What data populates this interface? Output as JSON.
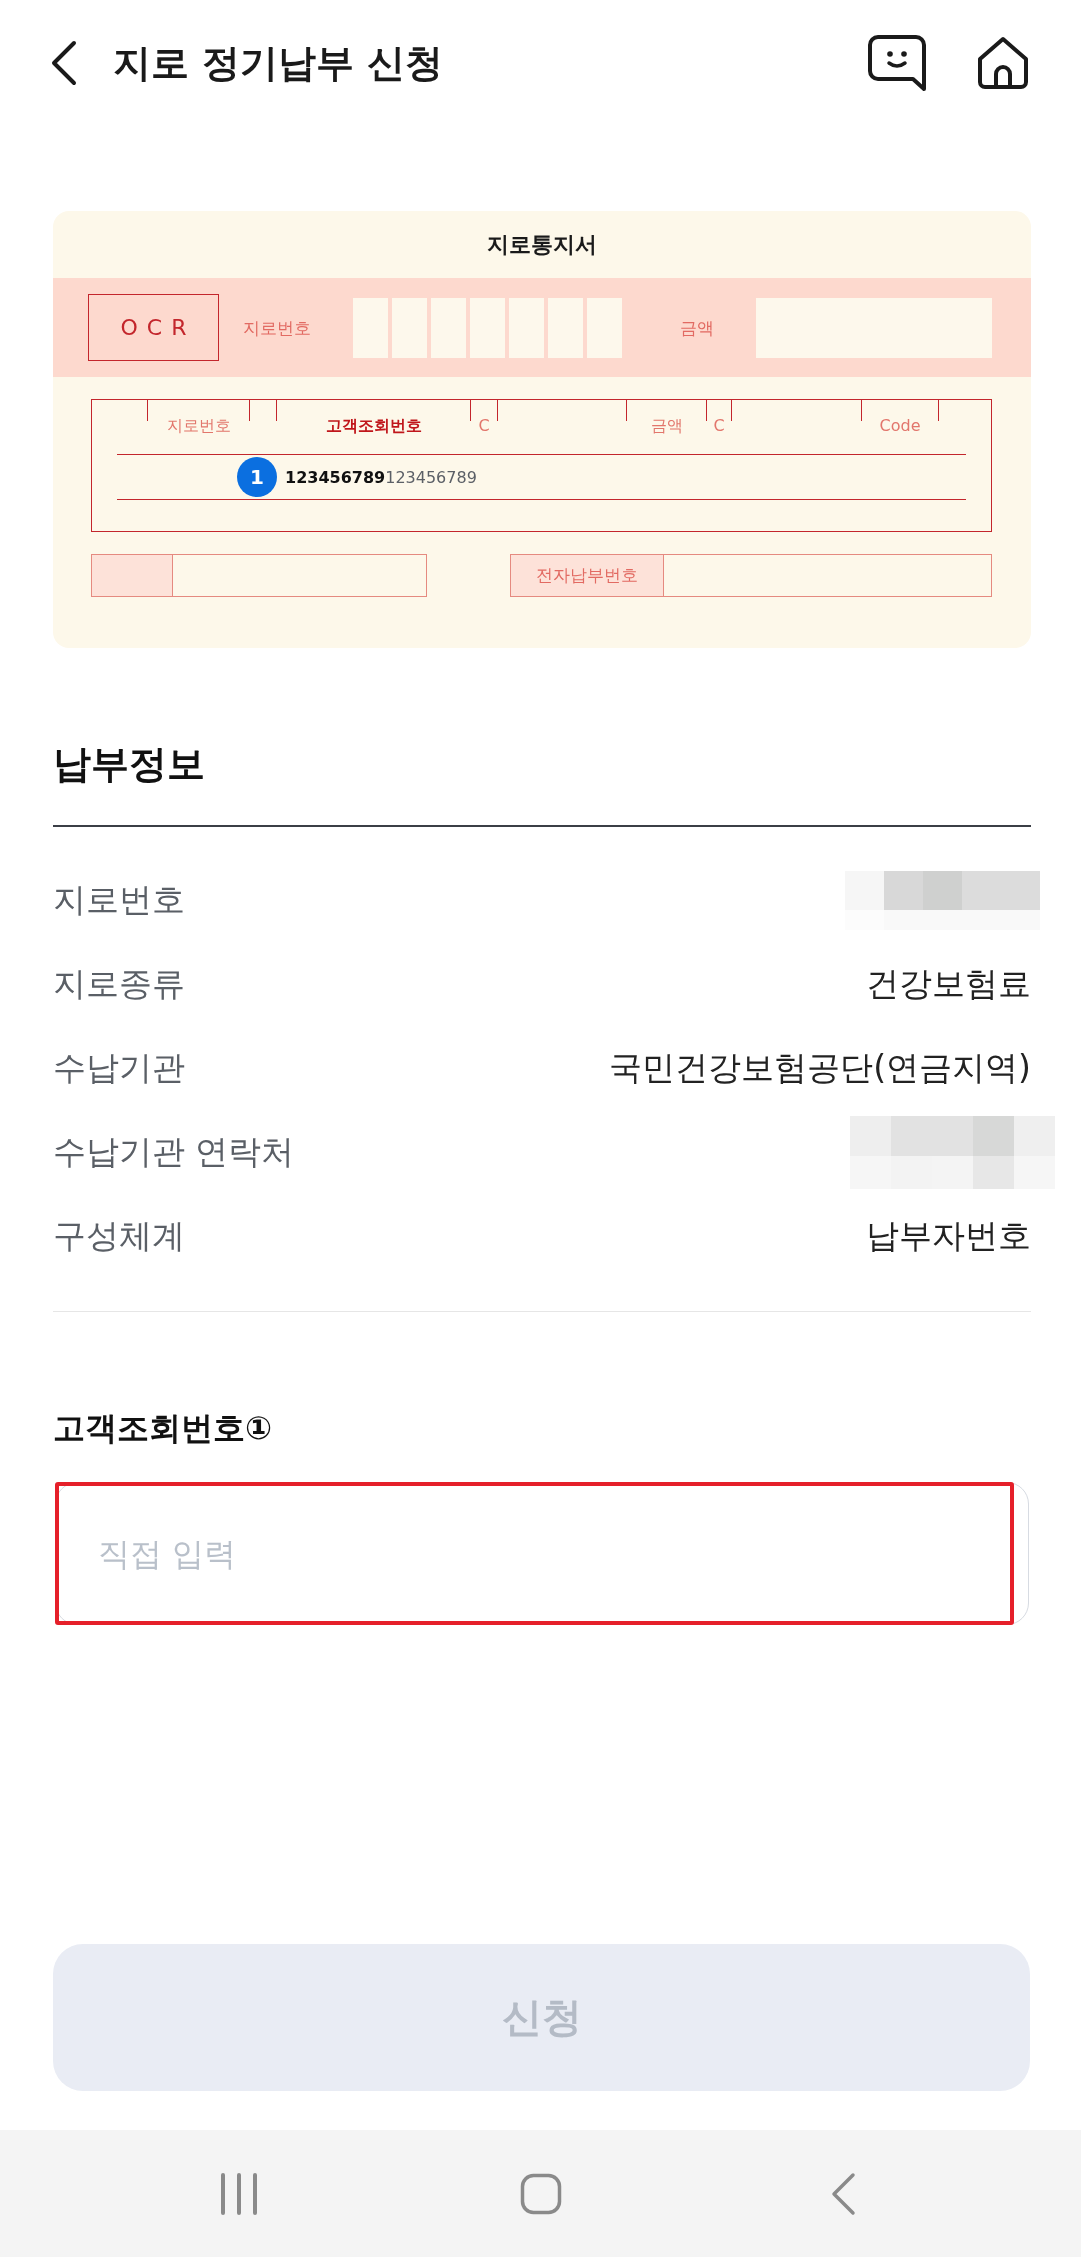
{
  "header": {
    "title": "지로 정기납부 신청"
  },
  "giro_notice": {
    "title": "지로통지서",
    "ocr_label": "OCR",
    "giro_number_label": "지로번호",
    "amount_label": "금액",
    "columns": [
      {
        "label": "지로번호",
        "highlighted": false
      },
      {
        "label": "고객조회번호",
        "highlighted": true
      },
      {
        "label": "C",
        "highlighted": false
      },
      {
        "label": "금액",
        "highlighted": false
      },
      {
        "label": "C",
        "highlighted": false
      },
      {
        "label": "Code",
        "highlighted": false
      }
    ],
    "marker": "1",
    "sample_number": "**123456789**123456789",
    "bottom_fields": [
      {
        "kind": "blank"
      },
      {
        "kind": "labeled",
        "label": "전자납부번호"
      }
    ]
  },
  "payment_info": {
    "title": "납부정보",
    "rows": [
      {
        "label": "지로번호",
        "kind": "masked"
      },
      {
        "label": "지로종류",
        "kind": "text",
        "value": "건강보험료"
      },
      {
        "label": "수납기관",
        "kind": "text",
        "value": "국민건강보험공단(연금지역)"
      },
      {
        "label": "수납기관 연락처",
        "kind": "masked"
      },
      {
        "label": "구성체계",
        "kind": "text",
        "value": "납부자번호"
      }
    ]
  },
  "lookup": {
    "label": "고객조회번호①",
    "placeholder": "직접 입력",
    "highlighted": true
  },
  "submit_button": {
    "label": "신청",
    "disabled": true
  }
}
